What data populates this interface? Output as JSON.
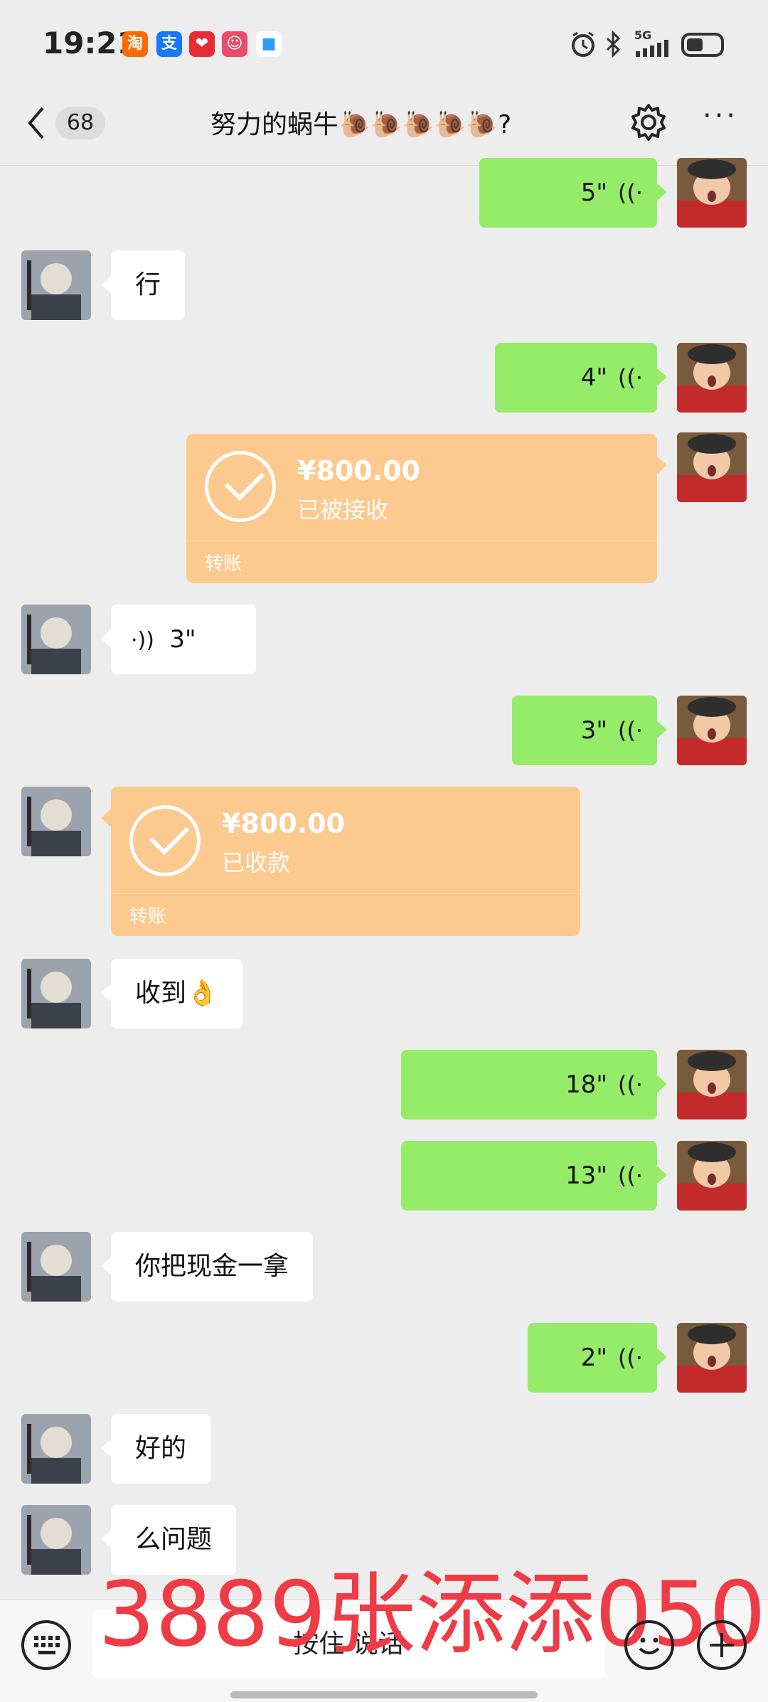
{
  "status_bar": {
    "time": "19:21",
    "app_icons": [
      {
        "name": "taobao-icon",
        "glyph": "淘",
        "color": "#ff6a00"
      },
      {
        "name": "alipay-icon",
        "glyph": "支",
        "color": "#1677ff"
      },
      {
        "name": "app-red-icon",
        "glyph": "❤",
        "color": "#e82c36"
      },
      {
        "name": "app-cartoon-icon",
        "glyph": "☺",
        "color": "#e94b6b"
      },
      {
        "name": "app-blue-icon",
        "glyph": "■",
        "color": "#2a9df4"
      }
    ],
    "network": "5G"
  },
  "header": {
    "unread_count": "68",
    "title": "努力的蜗牛🐌🐌🐌🐌🐌?"
  },
  "messages": {
    "m1": {
      "duration": "5\""
    },
    "m2": {
      "text": "行"
    },
    "m3": {
      "duration": "4\""
    },
    "m4": {
      "amount": "¥800.00",
      "status": "已被接收",
      "type": "转账"
    },
    "m5": {
      "duration": "3\""
    },
    "m6": {
      "duration": "3\""
    },
    "m7": {
      "amount": "¥800.00",
      "status": "已收款",
      "type": "转账"
    },
    "m8": {
      "text": "收到👌"
    },
    "m9": {
      "duration": "18\""
    },
    "m10": {
      "duration": "13\""
    },
    "m11": {
      "text": "你把现金一拿"
    },
    "m12": {
      "duration": "2\""
    },
    "m13": {
      "text": "好的"
    },
    "m14": {
      "text": "么问题"
    }
  },
  "watermark": "3889张添添050",
  "input_bar": {
    "hold_to_talk": "按住 说话"
  },
  "colors": {
    "sent_bubble": "#95ec69",
    "received_bubble": "#ffffff",
    "transfer_card": "#fcc98f",
    "watermark": "#ee3b46"
  }
}
